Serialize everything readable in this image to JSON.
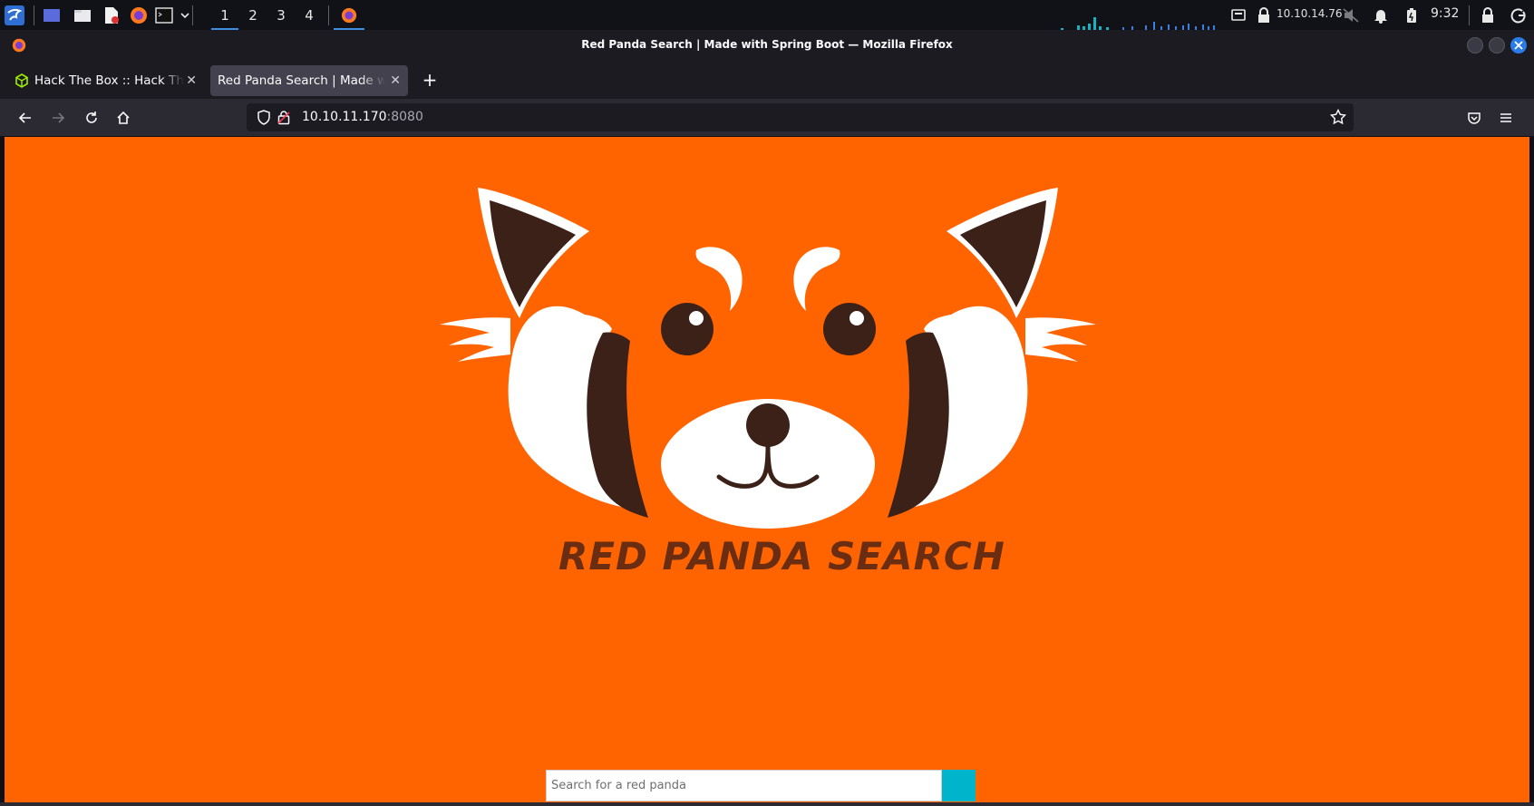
{
  "panel": {
    "workspaces": [
      "1",
      "2",
      "3",
      "4"
    ],
    "active_workspace": "1",
    "ip_address": "10.10.14.76",
    "clock": "9:32"
  },
  "window": {
    "title": "Red Panda Search | Made with Spring Boot — Mozilla Firefox"
  },
  "tabs": [
    {
      "label": "Hack The Box :: Hack The Box",
      "icon": "htb-cube-icon"
    },
    {
      "label": "Red Panda Search | Made with Spring Boot",
      "icon": ""
    }
  ],
  "urlbar": {
    "host": "10.10.11.170",
    "port": ":8080"
  },
  "page": {
    "logo_text": "RED PANDA SEARCH",
    "search": {
      "placeholder": "Search for a red panda",
      "value": ""
    }
  },
  "colors": {
    "page_background": "#ff6400",
    "search_button": "#00b4cc",
    "panda_dark": "#3b2117",
    "accent_blue": "#3d8ee0"
  }
}
